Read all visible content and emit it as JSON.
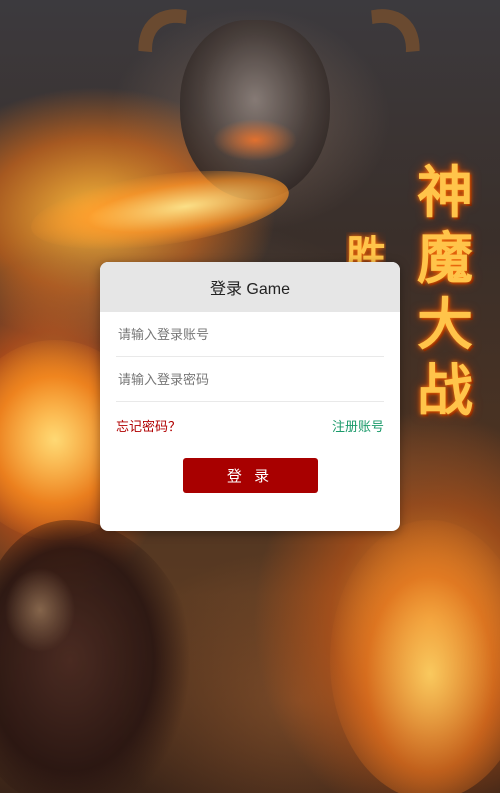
{
  "background": {
    "title_chars": [
      "神",
      "魔",
      "大",
      "战"
    ],
    "partial_char": "胜"
  },
  "login": {
    "header_title": "登录 Game",
    "account_placeholder": "请输入登录账号",
    "password_placeholder": "请输入登录密码",
    "forgot_label": "忘记密码？",
    "register_label": "注册账号",
    "submit_label": "登 录"
  },
  "colors": {
    "primary_button": "#a80000",
    "forgot_link": "#b00000",
    "register_link": "#1a9a6a",
    "header_bg": "#e6e6e6"
  }
}
